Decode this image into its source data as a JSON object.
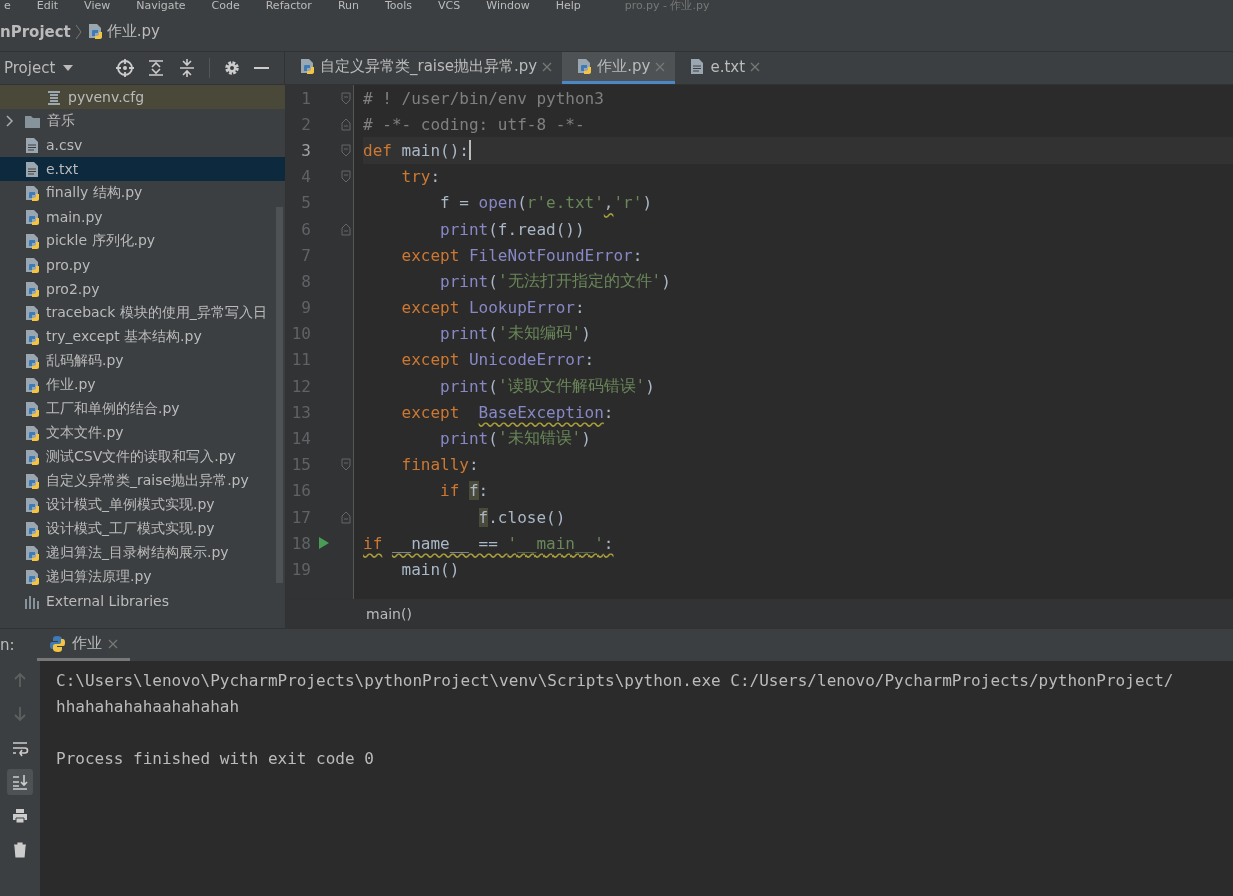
{
  "menu": {
    "items": [
      "e",
      "Edit",
      "View",
      "Navigate",
      "Code",
      "Refactor",
      "Run",
      "Tools",
      "VCS",
      "Window",
      "Help"
    ],
    "title": "pro.py - 作业.py"
  },
  "breadcrumb": [
    {
      "label": "nProject",
      "kind": "project"
    },
    {
      "label": "作业.py",
      "kind": "python"
    }
  ],
  "project_panel": {
    "title": "Project",
    "nested_items": [
      {
        "label": "pyvenv.cfg",
        "kind": "cfg",
        "selected": false
      }
    ],
    "items": [
      {
        "label": "音乐",
        "kind": "folder",
        "expanded": false,
        "selected": false
      },
      {
        "label": "a.csv",
        "kind": "text",
        "selected": false
      },
      {
        "label": "e.txt",
        "kind": "text",
        "selected": true
      },
      {
        "label": "finally 结构.py",
        "kind": "python",
        "selected": false
      },
      {
        "label": "main.py",
        "kind": "python",
        "selected": false
      },
      {
        "label": "pickle 序列化.py",
        "kind": "python",
        "selected": false
      },
      {
        "label": "pro.py",
        "kind": "python",
        "selected": false
      },
      {
        "label": "pro2.py",
        "kind": "python",
        "selected": false
      },
      {
        "label": "traceback 模块的使用_异常写入日",
        "kind": "python",
        "selected": false
      },
      {
        "label": "try_except 基本结构.py",
        "kind": "python",
        "selected": false
      },
      {
        "label": "乱码解码.py",
        "kind": "python",
        "selected": false
      },
      {
        "label": "作业.py",
        "kind": "python",
        "selected": false
      },
      {
        "label": "工厂和单例的结合.py",
        "kind": "python",
        "selected": false
      },
      {
        "label": "文本文件.py",
        "kind": "python",
        "selected": false
      },
      {
        "label": "测试CSV文件的读取和写入.py",
        "kind": "python",
        "selected": false
      },
      {
        "label": "自定义异常类_raise抛出异常.py",
        "kind": "python",
        "selected": false
      },
      {
        "label": "设计模式_单例模式实现.py",
        "kind": "python",
        "selected": false
      },
      {
        "label": "设计模式_工厂模式实现.py",
        "kind": "python",
        "selected": false
      },
      {
        "label": "递归算法_目录树结构展示.py",
        "kind": "python",
        "selected": false
      },
      {
        "label": "递归算法原理.py",
        "kind": "python",
        "selected": false
      },
      {
        "label": "External Libraries",
        "kind": "library",
        "selected": false
      }
    ]
  },
  "editor_tabs": [
    {
      "label": "自定义异常类_raise抛出异常.py",
      "kind": "python",
      "selected": false
    },
    {
      "label": "作业.py",
      "kind": "python",
      "selected": true
    },
    {
      "label": "e.txt",
      "kind": "text",
      "selected": false
    }
  ],
  "editor": {
    "lines": [
      {
        "number": "1",
        "current": false,
        "fold_start": true,
        "fold_end": false,
        "run": false,
        "segments": [
          {
            "text": "# ! /user/bin/env python3",
            "kind": "comment"
          }
        ]
      },
      {
        "number": "2",
        "current": false,
        "fold_start": false,
        "fold_end": true,
        "run": false,
        "segments": [
          {
            "text": "# -*- coding: utf-8 -*-",
            "kind": "comment"
          }
        ]
      },
      {
        "number": "3",
        "current": true,
        "fold_start": true,
        "fold_end": false,
        "run": false,
        "segments": [
          {
            "text": "def",
            "kind": "keyword"
          },
          {
            "text": " main():",
            "kind": "plain"
          }
        ]
      },
      {
        "number": "4",
        "current": false,
        "fold_start": true,
        "fold_end": false,
        "run": false,
        "segments": [
          {
            "text": "    try",
            "kind": "keyword"
          },
          {
            "text": ":",
            "kind": "plain"
          }
        ]
      },
      {
        "number": "5",
        "current": false,
        "fold_start": false,
        "fold_end": false,
        "run": false,
        "segments": [
          {
            "text": "        f = ",
            "kind": "plain"
          },
          {
            "text": "open",
            "kind": "builtin"
          },
          {
            "text": "(",
            "kind": "plain"
          },
          {
            "text": "r'e.txt'",
            "kind": "string"
          },
          {
            "text": ",",
            "kind": "plain",
            "squiggle": true
          },
          {
            "text": "'r'",
            "kind": "string"
          },
          {
            "text": ")",
            "kind": "plain"
          }
        ]
      },
      {
        "number": "6",
        "current": false,
        "fold_start": false,
        "fold_end": true,
        "run": false,
        "segments": [
          {
            "text": "        print",
            "kind": "builtin"
          },
          {
            "text": "(f.read())",
            "kind": "plain"
          }
        ]
      },
      {
        "number": "7",
        "current": false,
        "fold_start": false,
        "fold_end": false,
        "run": false,
        "segments": [
          {
            "text": "    except",
            "kind": "keyword"
          },
          {
            "text": " FileNotFoundError",
            "kind": "builtin"
          },
          {
            "text": ":",
            "kind": "plain"
          }
        ]
      },
      {
        "number": "8",
        "current": false,
        "fold_start": false,
        "fold_end": false,
        "run": false,
        "segments": [
          {
            "text": "        print",
            "kind": "builtin"
          },
          {
            "text": "(",
            "kind": "plain"
          },
          {
            "text": "'无法打开指定的文件'",
            "kind": "string"
          },
          {
            "text": ")",
            "kind": "plain"
          }
        ]
      },
      {
        "number": "9",
        "current": false,
        "fold_start": false,
        "fold_end": false,
        "run": false,
        "segments": [
          {
            "text": "    except",
            "kind": "keyword"
          },
          {
            "text": " LookupError",
            "kind": "builtin"
          },
          {
            "text": ":",
            "kind": "plain"
          }
        ]
      },
      {
        "number": "10",
        "current": false,
        "fold_start": false,
        "fold_end": false,
        "run": false,
        "segments": [
          {
            "text": "        print",
            "kind": "builtin"
          },
          {
            "text": "(",
            "kind": "plain"
          },
          {
            "text": "'未知编码'",
            "kind": "string"
          },
          {
            "text": ")",
            "kind": "plain"
          }
        ]
      },
      {
        "number": "11",
        "current": false,
        "fold_start": false,
        "fold_end": false,
        "run": false,
        "segments": [
          {
            "text": "    except",
            "kind": "keyword"
          },
          {
            "text": " UnicodeError",
            "kind": "builtin"
          },
          {
            "text": ":",
            "kind": "plain"
          }
        ]
      },
      {
        "number": "12",
        "current": false,
        "fold_start": false,
        "fold_end": false,
        "run": false,
        "segments": [
          {
            "text": "        print",
            "kind": "builtin"
          },
          {
            "text": "(",
            "kind": "plain"
          },
          {
            "text": "'读取文件解码错误'",
            "kind": "string"
          },
          {
            "text": ")",
            "kind": "plain"
          }
        ]
      },
      {
        "number": "13",
        "current": false,
        "fold_start": false,
        "fold_end": false,
        "run": false,
        "segments": [
          {
            "text": "    except",
            "kind": "keyword"
          },
          {
            "text": "  BaseException",
            "kind": "builtin",
            "squiggle": true
          },
          {
            "text": ":",
            "kind": "plain"
          }
        ]
      },
      {
        "number": "14",
        "current": false,
        "fold_start": false,
        "fold_end": false,
        "run": false,
        "segments": [
          {
            "text": "        print",
            "kind": "builtin"
          },
          {
            "text": "(",
            "kind": "plain"
          },
          {
            "text": "'未知错误'",
            "kind": "string"
          },
          {
            "text": ")",
            "kind": "plain"
          }
        ]
      },
      {
        "number": "15",
        "current": false,
        "fold_start": true,
        "fold_end": false,
        "run": false,
        "segments": [
          {
            "text": "    finally",
            "kind": "keyword"
          },
          {
            "text": ":",
            "kind": "plain"
          }
        ]
      },
      {
        "number": "16",
        "current": false,
        "fold_start": false,
        "fold_end": false,
        "run": false,
        "segments": [
          {
            "text": "        if",
            "kind": "keyword"
          },
          {
            "text": " f",
            "kind": "plain",
            "highlight": true
          },
          {
            "text": ":",
            "kind": "plain"
          }
        ]
      },
      {
        "number": "17",
        "current": false,
        "fold_start": false,
        "fold_end": true,
        "run": false,
        "segments": [
          {
            "text": "            f",
            "kind": "plain",
            "highlight": true
          },
          {
            "text": ".close()",
            "kind": "plain"
          }
        ]
      },
      {
        "number": "18",
        "current": false,
        "fold_start": false,
        "fold_end": false,
        "run": true,
        "segments": [
          {
            "text": "if",
            "kind": "keyword",
            "squiggle": true
          },
          {
            "text": " __name__ == ",
            "kind": "plain",
            "squiggle": true
          },
          {
            "text": "'__main__'",
            "kind": "string",
            "squiggle": true
          },
          {
            "text": ":",
            "kind": "plain",
            "squiggle": true
          }
        ]
      },
      {
        "number": "19",
        "current": false,
        "fold_start": false,
        "fold_end": false,
        "run": false,
        "segments": [
          {
            "text": "    main()",
            "kind": "plain"
          }
        ]
      }
    ],
    "breadcrumb": "main()"
  },
  "run_panel": {
    "label": "n:",
    "tabs": [
      {
        "label": "作业",
        "selected": true
      }
    ],
    "output_blocks": [
      [
        "C:\\Users\\lenovo\\PycharmProjects\\pythonProject\\venv\\Scripts\\python.exe C:/Users/lenovo/PycharmProjects/pythonProject/",
        "hhahahahahaahahahah"
      ],
      [
        "Process finished with exit code 0"
      ]
    ]
  }
}
